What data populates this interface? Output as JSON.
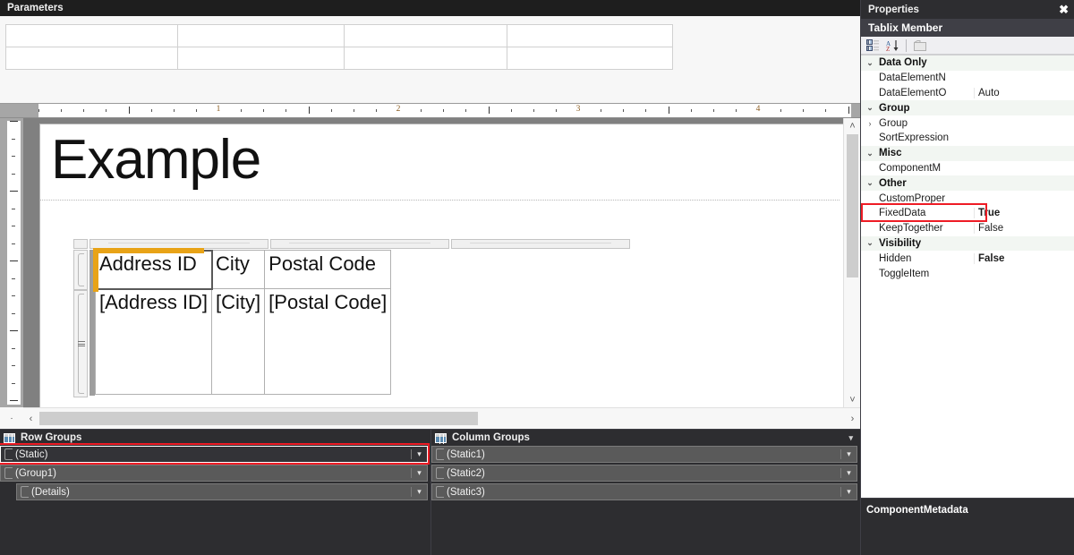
{
  "parameters_panel": {
    "title": "Parameters",
    "grid_rows": 2,
    "grid_cols": 4,
    "cells": [
      [
        "",
        "",
        "",
        ""
      ],
      [
        "",
        "",
        "",
        ""
      ]
    ]
  },
  "design_surface": {
    "report_title": "Example",
    "horizontal_ruler": {
      "labels": [
        "1",
        "2",
        "3",
        "4"
      ],
      "unit": "inches"
    },
    "tablix": {
      "header_row": [
        "Address ID",
        "City",
        "Postal Code"
      ],
      "detail_row": [
        "[Address ID]",
        "[City]",
        "[Postal Code]"
      ],
      "selected_cell": "Address ID",
      "selection_color": "#e8a317"
    },
    "scroll": {
      "left_arrow": "‹",
      "right_arrow": "›",
      "up_arrow": "˄",
      "down_arrow": "˅",
      "collapse": "·"
    }
  },
  "grouping_pane": {
    "row_groups": {
      "title": "Row Groups",
      "items": [
        {
          "label": "(Static)",
          "indent": 0,
          "selected": true,
          "annotated": true
        },
        {
          "label": "(Group1)",
          "indent": 0,
          "selected": false,
          "annotated": false
        },
        {
          "label": "(Details)",
          "indent": 1,
          "selected": false,
          "annotated": false
        }
      ]
    },
    "column_groups": {
      "title": "Column Groups",
      "items": [
        {
          "label": "(Static1)",
          "indent": 0,
          "selected": false,
          "annotated": false
        },
        {
          "label": "(Static2)",
          "indent": 0,
          "selected": false,
          "annotated": false
        },
        {
          "label": "(Static3)",
          "indent": 0,
          "selected": false,
          "annotated": false
        }
      ]
    },
    "caret": "▾"
  },
  "properties_panel": {
    "title": "Properties",
    "close_label": "✖",
    "object_name": "Tablix Member",
    "toolbar": {
      "categorized_icon": "categorized-view-icon",
      "alphabetical_icon": "alphabetical-sort-icon",
      "property_pages_icon": "property-pages-icon"
    },
    "rows": [
      {
        "kind": "category",
        "expander": "⌄",
        "name": "Data Only",
        "value": ""
      },
      {
        "kind": "property",
        "expander": "",
        "name": "DataElementN",
        "value": ""
      },
      {
        "kind": "property",
        "expander": "",
        "name": "DataElementO",
        "value": "Auto"
      },
      {
        "kind": "category",
        "expander": "⌄",
        "name": "Group",
        "value": ""
      },
      {
        "kind": "property",
        "expander": "›",
        "name": "Group",
        "value": ""
      },
      {
        "kind": "property",
        "expander": "",
        "name": "SortExpression",
        "value": ""
      },
      {
        "kind": "category",
        "expander": "⌄",
        "name": "Misc",
        "value": ""
      },
      {
        "kind": "property",
        "expander": "",
        "name": "ComponentM",
        "value": ""
      },
      {
        "kind": "category",
        "expander": "⌄",
        "name": "Other",
        "value": ""
      },
      {
        "kind": "property",
        "expander": "",
        "name": "CustomProper",
        "value": ""
      },
      {
        "kind": "property",
        "expander": "",
        "name": "FixedData",
        "value": "True",
        "bold_value": true,
        "annotated": true
      },
      {
        "kind": "property",
        "expander": "",
        "name": "KeepTogether",
        "value": "False"
      },
      {
        "kind": "category",
        "expander": "⌄",
        "name": "Visibility",
        "value": ""
      },
      {
        "kind": "property",
        "expander": "",
        "name": "Hidden",
        "value": "False",
        "bold_value": true
      },
      {
        "kind": "property",
        "expander": "",
        "name": "ToggleItem",
        "value": ""
      }
    ],
    "description_title": "ComponentMetadata"
  },
  "colors": {
    "annotation": "#ee1c25",
    "chrome_dark": "#2d2d30",
    "titlebar_dark": "#1e1e1e",
    "selection_orange": "#e8a317",
    "group_row": "#5a5a5a"
  }
}
